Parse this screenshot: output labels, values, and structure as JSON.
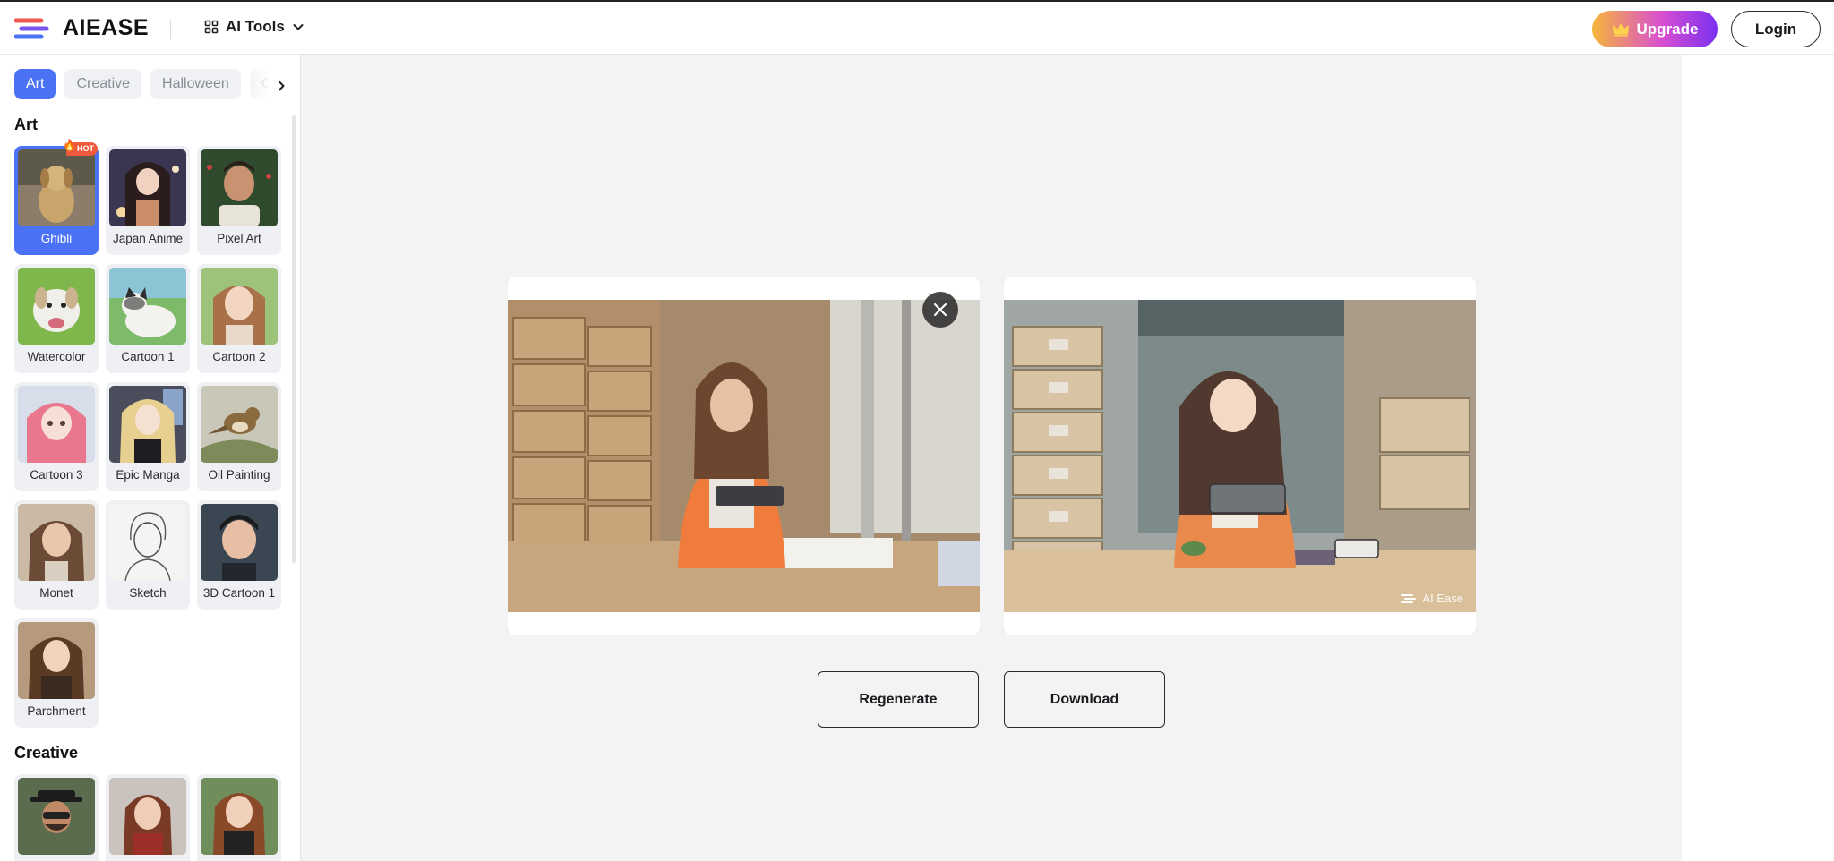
{
  "header": {
    "brand": "AIEASE",
    "ai_tools_label": "AI Tools",
    "upgrade_label": "Upgrade",
    "login_label": "Login"
  },
  "sidebar": {
    "tabs": [
      {
        "label": "Art",
        "active": true
      },
      {
        "label": "Creative",
        "active": false
      },
      {
        "label": "Halloween",
        "active": false
      },
      {
        "label": "Ch",
        "active": false
      }
    ],
    "sections": [
      {
        "title": "Art",
        "items": [
          {
            "label": "Ghibli",
            "selected": true,
            "badge": "HOT"
          },
          {
            "label": "Japan Anime"
          },
          {
            "label": "Pixel Art"
          },
          {
            "label": "Watercolor"
          },
          {
            "label": "Cartoon 1"
          },
          {
            "label": "Cartoon 2"
          },
          {
            "label": "Cartoon 3"
          },
          {
            "label": "Epic Manga"
          },
          {
            "label": "Oil Painting"
          },
          {
            "label": "Monet"
          },
          {
            "label": "Sketch"
          },
          {
            "label": "3D Cartoon 1"
          },
          {
            "label": "Parchment"
          }
        ]
      },
      {
        "title": "Creative",
        "items": []
      }
    ]
  },
  "main": {
    "watermark": "AI Ease",
    "regenerate_label": "Regenerate",
    "download_label": "Download"
  },
  "colors": {
    "accent": "#4b72f5",
    "hot": "#ef5a3c",
    "background": "#f3f3f4"
  }
}
